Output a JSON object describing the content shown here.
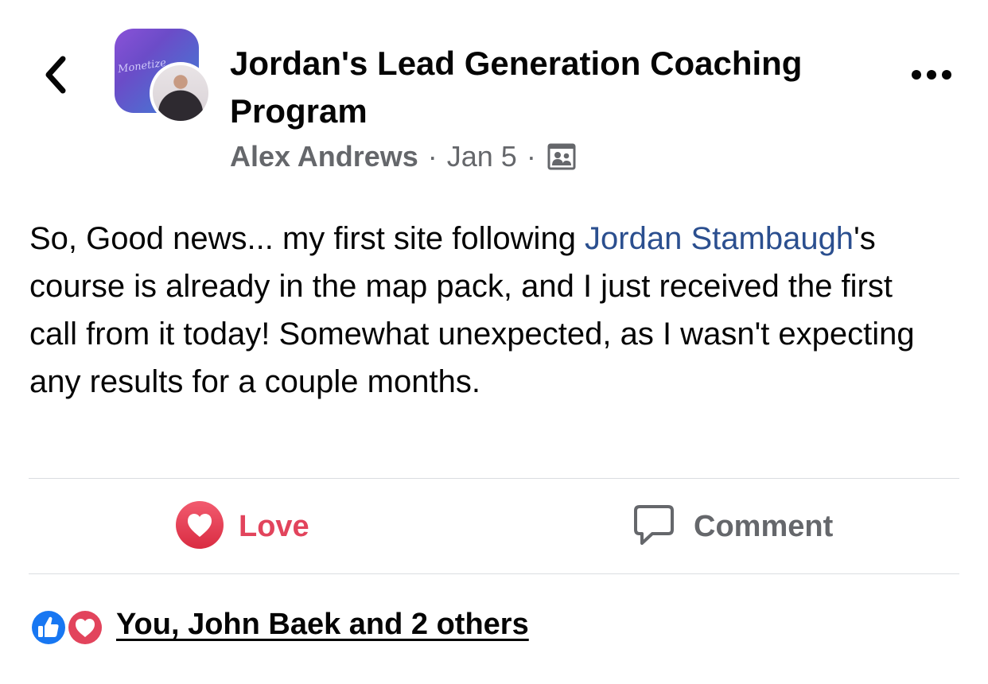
{
  "header": {
    "back_icon": "chevron-left-icon",
    "group_name": "Jordan's Lead Generation Coaching Program",
    "group_avatar_text": "Monetize",
    "author": "Alex Andrews",
    "separator": "·",
    "date": "Jan 5",
    "audience_icon": "group-members-icon",
    "more_icon": "more-horizontal-icon"
  },
  "post": {
    "text_before_mention": "So, Good news... my first site following ",
    "mention": "Jordan Stambaugh",
    "text_after_mention": "'s course is already in the map pack, and I just received the first call from it today! Somewhat unexpected, as I wasn't expecting any results for a couple months."
  },
  "actions": {
    "love_label": "Love",
    "comment_label": "Comment",
    "love_color": "#e2445c"
  },
  "reactions": {
    "summary": "You, John Baek and 2 others",
    "icons": [
      "like-icon",
      "love-icon"
    ]
  },
  "colors": {
    "mention": "#2b4f8f",
    "secondary_text": "#65676b",
    "like_blue": "#1877f2",
    "love_red": "#e2445c"
  }
}
